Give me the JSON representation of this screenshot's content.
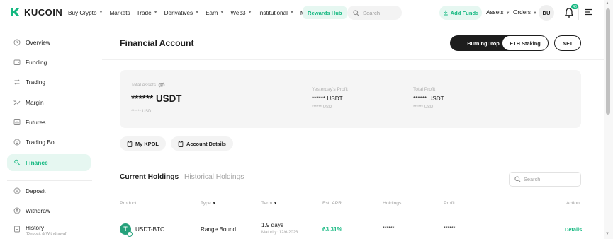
{
  "brand": {
    "name": "KUCOIN",
    "accent": "#14b880"
  },
  "topnav": {
    "items": [
      {
        "label": "Buy Crypto",
        "caret": true
      },
      {
        "label": "Markets",
        "caret": false
      },
      {
        "label": "Trade",
        "caret": true
      },
      {
        "label": "Derivatives",
        "caret": true
      },
      {
        "label": "Earn",
        "caret": true
      },
      {
        "label": "Web3",
        "caret": true
      },
      {
        "label": "Institutional",
        "caret": true
      },
      {
        "label": "More",
        "caret": true
      }
    ],
    "rewards_label": "Rewards Hub",
    "search_placeholder": "Search",
    "add_funds_label": "Add Funds",
    "assets_label": "Assets",
    "orders_label": "Orders",
    "avatar_initials": "DU",
    "notification_count": "46"
  },
  "sidebar": {
    "items": [
      {
        "label": "Overview",
        "icon": "clock-icon"
      },
      {
        "label": "Funding",
        "icon": "wallet-icon"
      },
      {
        "label": "Trading",
        "icon": "trading-icon"
      },
      {
        "label": "Margin",
        "icon": "margin-icon"
      },
      {
        "label": "Futures",
        "icon": "futures-icon"
      },
      {
        "label": "Trading Bot",
        "icon": "bot-icon"
      },
      {
        "label": "Finance",
        "icon": "finance-icon",
        "active": true
      },
      {
        "label": "Deposit",
        "icon": "deposit-icon"
      },
      {
        "label": "Withdraw",
        "icon": "withdraw-icon"
      },
      {
        "label": "History",
        "sub": "(Deposit & Withdrawal)",
        "icon": "history-icon"
      }
    ]
  },
  "header": {
    "title": "Financial Account",
    "buttons": [
      "BurningDrop",
      "ETH Staking",
      "NFT"
    ]
  },
  "summary": {
    "total_assets_label": "Total Assets",
    "total_assets_value": "****** USDT",
    "total_assets_usd": "****** USD",
    "yesterday_label": "Yesterday's Profit",
    "yesterday_value": "****** USDT",
    "yesterday_usd": "****** USD",
    "total_profit_label": "Total Profit",
    "total_profit_value": "****** USDT",
    "total_profit_usd": "****** USD"
  },
  "actions": {
    "my_kpol": "My KPOL",
    "account_details": "Account Details"
  },
  "tabs": {
    "current": "Current Holdings",
    "historical": "Historical Holdings"
  },
  "table_search_placeholder": "Search",
  "columns": [
    "Product",
    "Type",
    "Term",
    "Est. APR",
    "Holdings",
    "Profit",
    "Action"
  ],
  "rows": [
    {
      "product": "USDT-BTC",
      "type": "Range Bound",
      "term": "1.9 days",
      "maturity": "Maturity: 12/6/2023",
      "apr": "63.31%",
      "holdings": "******",
      "profit": "******",
      "action": "Details"
    }
  ]
}
